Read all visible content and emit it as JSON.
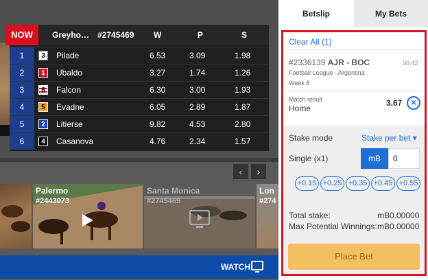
{
  "race": {
    "now_label": "NOW",
    "title": "Greyho…",
    "race_id": "#2745469",
    "col_w": "W",
    "col_p": "P",
    "col_s": "S",
    "runners": [
      {
        "num": "1",
        "trap": "3",
        "name": "Pilade",
        "w": "6.53",
        "p": "3.09",
        "s": "1.98"
      },
      {
        "num": "2",
        "trap": "1",
        "name": "Ubaldo",
        "w": "3.27",
        "p": "1.74",
        "s": "1.26"
      },
      {
        "num": "3",
        "trap": "6",
        "name": "Falcon",
        "w": "6.30",
        "p": "3.00",
        "s": "1.93"
      },
      {
        "num": "4",
        "trap": "5",
        "name": "Evadne",
        "w": "6.05",
        "p": "2.89",
        "s": "1.87"
      },
      {
        "num": "5",
        "trap": "2",
        "name": "Litierse",
        "w": "9.82",
        "p": "4.53",
        "s": "2.80"
      },
      {
        "num": "6",
        "trap": "4",
        "name": "Casanova",
        "w": "4.76",
        "p": "2.34",
        "s": "1.57"
      }
    ]
  },
  "nav": {
    "prev": "‹",
    "next": "›"
  },
  "streams": [
    {
      "title": "",
      "id": ""
    },
    {
      "title": "Palermo",
      "id": "#2443073"
    },
    {
      "title": "Santa Monica",
      "id": "#2745469"
    },
    {
      "title": "Lon",
      "id": "#274"
    }
  ],
  "watch": {
    "label": "WATCH"
  },
  "betslip": {
    "tab_active": "Betslip",
    "tab_inactive": "My Bets",
    "clear_all": "Clear All (1)",
    "event_id": "#2336139",
    "event_name": "AJR - BOC",
    "event_time": "00:42",
    "league": "Football League - Argentina",
    "week": "Week 8",
    "market_label": "Match result",
    "selection": "Home",
    "odds": "3.67",
    "stake_mode_label": "Stake mode",
    "stake_mode_value": "Stake per bet ▾",
    "single_label": "Single (x1)",
    "currency": "mB",
    "stake_value": "0",
    "quick_stakes": [
      "+0.15",
      "+0.25",
      "+0.35",
      "+0.45",
      "+0.55"
    ],
    "total_stake_label": "Total stake:",
    "total_stake_value": "mB0.00000",
    "max_win_label": "Max Potential Winnings:",
    "max_win_value": "mB0.00000",
    "place_bet": "Place Bet"
  },
  "colors": {
    "accent_blue": "#1f6fd6",
    "now_red": "#d8101f",
    "highlight_frame": "#d9141f",
    "place_bet_bg": "#f2c062",
    "watch_bar": "#0d4ca8"
  }
}
